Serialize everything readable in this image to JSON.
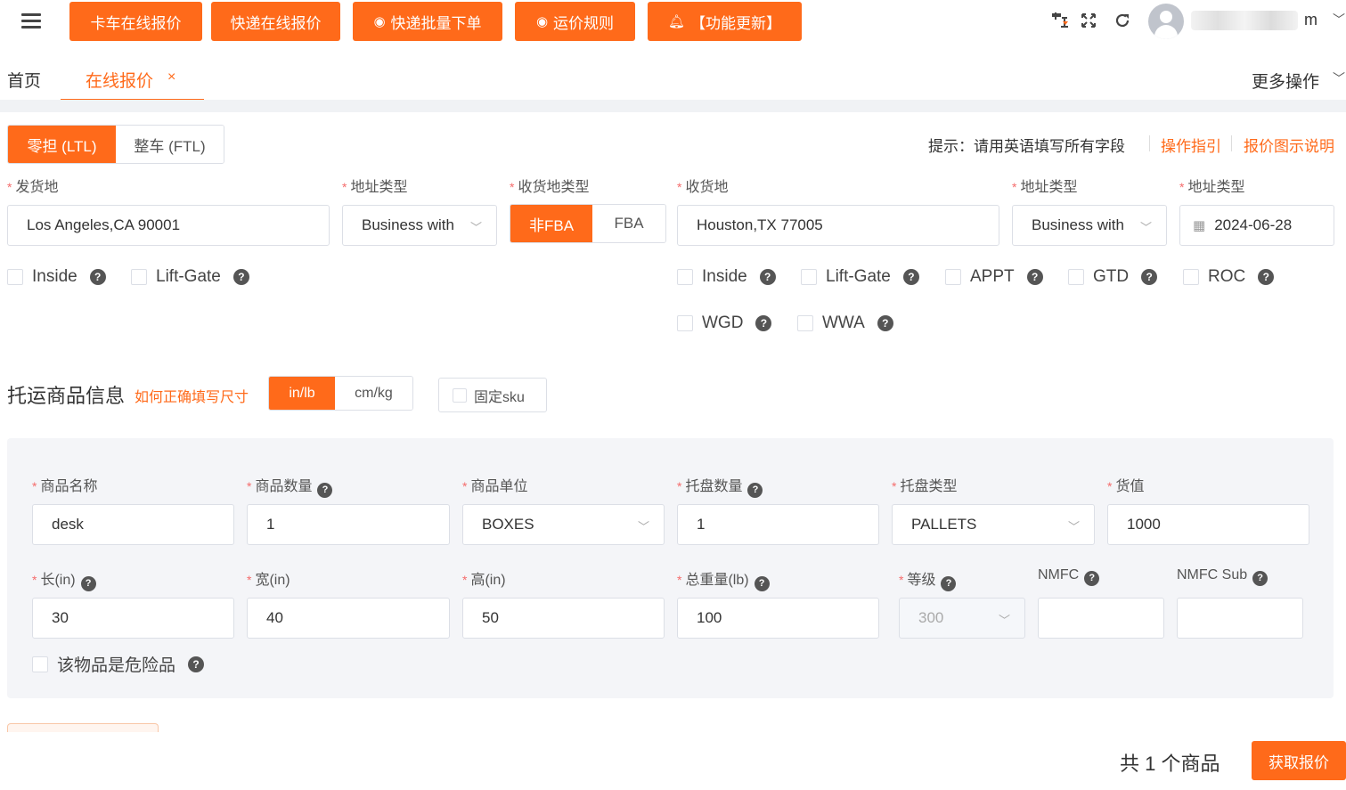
{
  "toolbar": {
    "buttons": [
      {
        "label": "卡车在线报价",
        "icon": ""
      },
      {
        "label": "快递在线报价",
        "icon": ""
      },
      {
        "label": "快递批量下单",
        "icon": "eye-icon"
      },
      {
        "label": "运价规则",
        "icon": "eye-icon"
      },
      {
        "label": "【功能更新】",
        "icon": "bell-icon"
      }
    ],
    "icons": [
      "translate-icon",
      "fullscreen-icon",
      "refresh-icon"
    ],
    "user_name": "m"
  },
  "tabs": {
    "home": "首页",
    "active": "在线报价",
    "close": "×",
    "more": "更多操作"
  },
  "mode": {
    "ltl": "零担 (LTL)",
    "ftl": "整车 (FTL)",
    "selected": "ltl"
  },
  "hint": {
    "text": "提示：请用英语填写所有字段",
    "guide": "操作指引",
    "illustration": "报价图示说明"
  },
  "shipment": {
    "origin_label": "发货地",
    "origin_value": "Los Angeles,CA 90001",
    "origin_addr_type_label": "地址类型",
    "origin_addr_type_value": "Business with",
    "dest_type_label": "收货地类型",
    "dest_type_options": [
      "非FBA",
      "FBA"
    ],
    "dest_type_selected": "非FBA",
    "dest_label": "收货地",
    "dest_value": "Houston,TX 77005",
    "dest_addr_type_label": "地址类型",
    "dest_addr_type_value": "Business with",
    "date_label": "地址类型",
    "date_value": "2024-06-28",
    "origin_options": [
      "Inside",
      "Lift-Gate"
    ],
    "dest_options": [
      "Inside",
      "Lift-Gate",
      "APPT",
      "GTD",
      "ROC",
      "WGD",
      "WWA"
    ]
  },
  "goods_section": {
    "title": "托运商品信息",
    "size_help_link": "如何正确填写尺寸",
    "units": [
      "in/lb",
      "cm/kg"
    ],
    "unit_selected": "in/lb",
    "fixed_sku": "固定sku"
  },
  "goods": {
    "name_label": "商品名称",
    "name_value": "desk",
    "qty_label": "商品数量",
    "qty_value": "1",
    "unit_label": "商品单位",
    "unit_value": "BOXES",
    "pallet_qty_label": "托盘数量",
    "pallet_qty_value": "1",
    "pallet_type_label": "托盘类型",
    "pallet_type_value": "PALLETS",
    "value_label": "货值",
    "value_value": "1000",
    "length_label": "长(in)",
    "length_value": "30",
    "width_label": "宽(in)",
    "width_value": "40",
    "height_label": "高(in)",
    "height_value": "50",
    "weight_label": "总重量(lb)",
    "weight_value": "100",
    "class_label": "等级",
    "class_value": "300",
    "nmfc_label": "NMFC",
    "nmfc_value": "",
    "nmfc_sub_label": "NMFC Sub",
    "nmfc_sub_value": "",
    "hazmat_label": "该物品是危险品"
  },
  "footer": {
    "count_text": "共 1 个商品",
    "quote_button": "获取报价"
  },
  "colors": {
    "accent": "#ff6a1a",
    "required": "#f56c6c",
    "panel_bg": "#f4f5f8"
  }
}
